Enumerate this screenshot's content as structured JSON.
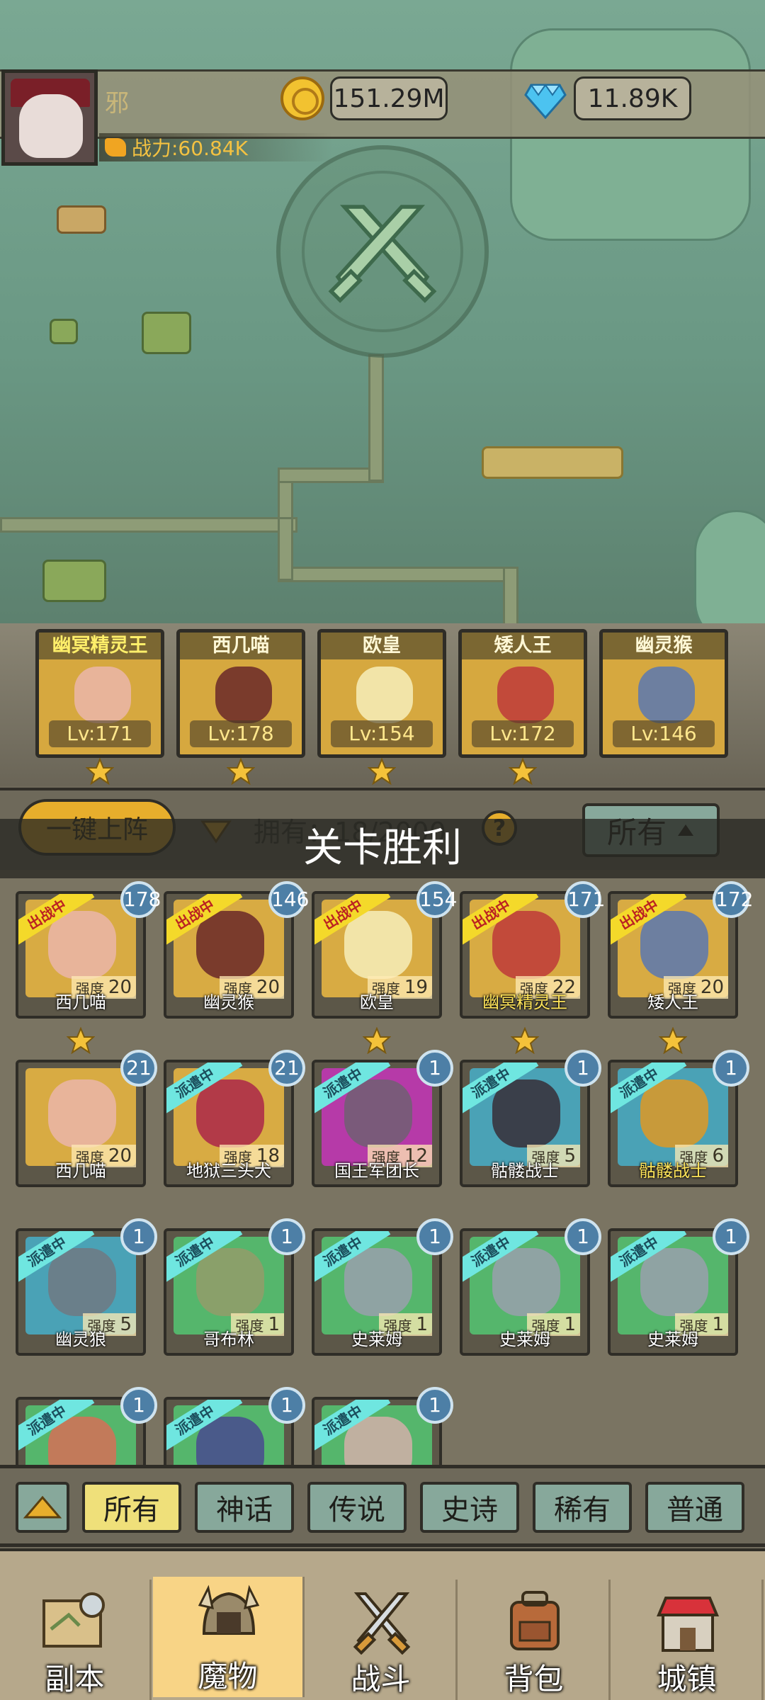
{
  "player": {
    "name": "邪",
    "power": "战力:60.84K",
    "gold": "151.29M",
    "gems": "11.89K"
  },
  "team": [
    {
      "name": "幽冥精灵王",
      "level": "Lv:171",
      "star": true,
      "name_color": "yellow"
    },
    {
      "name": "西几喵",
      "level": "Lv:178",
      "star": true,
      "name_color": "white"
    },
    {
      "name": "欧皇",
      "level": "Lv:154",
      "star": true,
      "name_color": "white"
    },
    {
      "name": "矮人王",
      "level": "Lv:172",
      "star": true,
      "name_color": "white"
    },
    {
      "name": "幽灵猴",
      "level": "Lv:146",
      "star": false,
      "name_color": "white"
    }
  ],
  "actions": {
    "deploy_all": "一键上阵",
    "owned": "拥有：18/2000",
    "help": "?",
    "filter_all": "所有"
  },
  "overlay": {
    "victory": "关卡胜利"
  },
  "labels": {
    "strength": "强度",
    "in_battle": "出战中",
    "dispatched": "派遣中"
  },
  "monsters": [
    {
      "name": "西几喵",
      "level": "178",
      "strength": "20",
      "status": "出战中",
      "frame": "gold",
      "star": true,
      "name_gold": false
    },
    {
      "name": "幽灵猴",
      "level": "146",
      "strength": "20",
      "status": "出战中",
      "frame": "gold",
      "star": false,
      "name_gold": false
    },
    {
      "name": "欧皇",
      "level": "154",
      "strength": "19",
      "status": "出战中",
      "frame": "gold",
      "star": true,
      "name_gold": false
    },
    {
      "name": "幽冥精灵王",
      "level": "171",
      "strength": "22",
      "status": "出战中",
      "frame": "gold",
      "star": true,
      "name_gold": true
    },
    {
      "name": "矮人王",
      "level": "172",
      "strength": "20",
      "status": "出战中",
      "frame": "gold",
      "star": true,
      "name_gold": false
    },
    {
      "name": "西几喵",
      "level": "21",
      "strength": "20",
      "status": "",
      "frame": "gold",
      "star": false,
      "name_gold": false
    },
    {
      "name": "地狱三头犬",
      "level": "21",
      "strength": "18",
      "status": "派遣中",
      "frame": "gold",
      "star": false,
      "name_gold": false
    },
    {
      "name": "国王军团长",
      "level": "1",
      "strength": "12",
      "status": "派遣中",
      "frame": "purple",
      "star": false,
      "name_gold": false
    },
    {
      "name": "骷髅战士",
      "level": "1",
      "strength": "5",
      "status": "派遣中",
      "frame": "teal",
      "star": false,
      "name_gold": false
    },
    {
      "name": "骷髅战士",
      "level": "1",
      "strength": "6",
      "status": "派遣中",
      "frame": "teal",
      "star": false,
      "name_gold": true
    },
    {
      "name": "幽灵狼",
      "level": "1",
      "strength": "5",
      "status": "派遣中",
      "frame": "teal",
      "star": false,
      "name_gold": false
    },
    {
      "name": "哥布林",
      "level": "1",
      "strength": "1",
      "status": "派遣中",
      "frame": "green",
      "star": false,
      "name_gold": false
    },
    {
      "name": "史莱姆",
      "level": "1",
      "strength": "1",
      "status": "派遣中",
      "frame": "green",
      "star": false,
      "name_gold": false
    },
    {
      "name": "史莱姆",
      "level": "1",
      "strength": "1",
      "status": "派遣中",
      "frame": "green",
      "star": false,
      "name_gold": false
    },
    {
      "name": "史莱姆",
      "level": "1",
      "strength": "1",
      "status": "派遣中",
      "frame": "green",
      "star": false,
      "name_gold": false
    },
    {
      "name": "",
      "level": "1",
      "strength": "",
      "status": "派遣中",
      "frame": "green",
      "star": false,
      "name_gold": false
    },
    {
      "name": "",
      "level": "1",
      "strength": "",
      "status": "派遣中",
      "frame": "green",
      "star": false,
      "name_gold": false
    },
    {
      "name": "",
      "level": "1",
      "strength": "",
      "status": "派遣中",
      "frame": "green",
      "star": false,
      "name_gold": false
    }
  ],
  "rarity_filters": [
    "所有",
    "神话",
    "传说",
    "史诗",
    "稀有",
    "普通"
  ],
  "rarity_active": "所有",
  "nav": [
    {
      "label": "副本",
      "icon": "map-icon",
      "active": false
    },
    {
      "label": "魔物",
      "icon": "monster-helmet-icon",
      "active": true
    },
    {
      "label": "战斗",
      "icon": "crossed-swords-icon",
      "active": false
    },
    {
      "label": "背包",
      "icon": "backpack-icon",
      "active": false
    },
    {
      "label": "城镇",
      "icon": "town-shop-icon",
      "active": false
    }
  ],
  "colors": {
    "gold_frame": "#d8ab43",
    "teal_frame": "#4aa2b6",
    "green_frame": "#55b66c",
    "purple_frame": "#b63aa8",
    "level_badge": "#4d7fa6",
    "accent": "#e7ae2c"
  }
}
